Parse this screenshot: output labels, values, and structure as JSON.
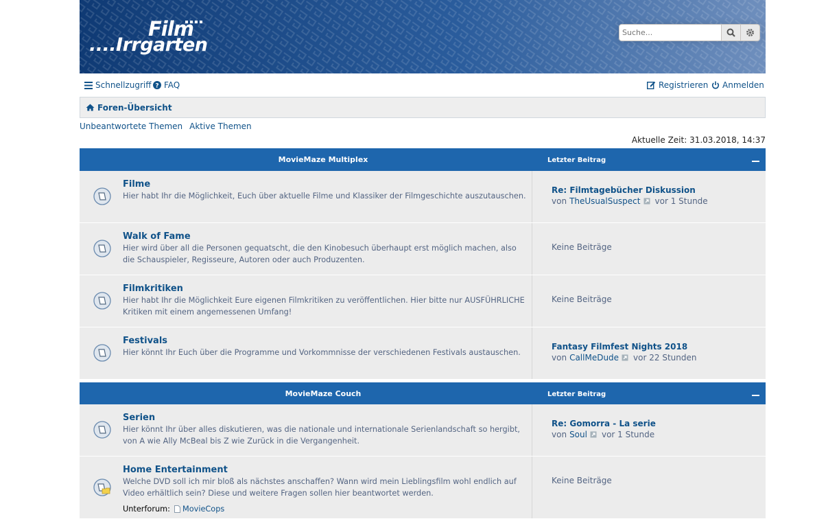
{
  "header": {
    "logo_top": "Film",
    "logo_bottom": "....Irrgarten",
    "search_placeholder": "Suche...",
    "search_icon": "search-icon",
    "advanced_icon": "gear-icon"
  },
  "nav": {
    "quick_access": "Schnellzugriff",
    "faq": "FAQ",
    "register": "Registrieren",
    "login": "Anmelden"
  },
  "breadcrumb": {
    "home": "Foren-Übersicht"
  },
  "quicklinks": {
    "unanswered": "Unbeantwortete Themen",
    "active": "Aktive Themen"
  },
  "time": "Aktuelle Zeit: 31.03.2018, 14:37",
  "colors": {
    "header": "#12407b",
    "category": "#1e66ad",
    "link": "#105289",
    "row": "#ececec"
  },
  "categories": [
    {
      "title": "MovieMaze Multiplex",
      "last_label": "Letzter Beitrag",
      "forums": [
        {
          "title": "Filme",
          "desc": "Hier habt Ihr die Möglichkeit, Euch über aktuelle Filme und Klassiker der Filmgeschichte auszutauschen.",
          "last_title": "Re: Filmtagebücher Diskussion",
          "by": "von",
          "user": "TheUsualSuspect",
          "when": "vor 1 Stunde"
        },
        {
          "title": "Walk of Fame",
          "desc": "Hier wird über all die Personen gequatscht, die den Kinobesuch überhaupt erst möglich machen, also die Schauspieler, Regisseure, Autoren oder auch Produzenten.",
          "none": "Keine Beiträge"
        },
        {
          "title": "Filmkritiken",
          "desc": "Hier habt Ihr die Möglichkeit Eure eigenen Filmkritiken zu veröffentlichen. Hier bitte nur AUSFÜHRLICHE Kritiken mit einem angemessenen Umfang!",
          "none": "Keine Beiträge"
        },
        {
          "title": "Festivals",
          "desc": "Hier könnt Ihr Euch über die Programme und Vorkommnisse der verschiedenen Festivals austauschen.",
          "last_title": "Fantasy Filmfest Nights 2018",
          "by": "von",
          "user": "CallMeDude",
          "when": "vor 22 Stunden"
        }
      ]
    },
    {
      "title": "MovieMaze Couch",
      "last_label": "Letzter Beitrag",
      "forums": [
        {
          "title": "Serien",
          "desc": "Hier könnt Ihr über alles diskutieren, was die nationale und internationale Serienlandschaft so hergibt, von A wie Ally McBeal bis Z wie Zurück in die Vergangenheit.",
          "last_title": "Re: Gomorra - La serie",
          "by": "von",
          "user": "Soul",
          "when": "vor 1 Stunde"
        },
        {
          "title": "Home Entertainment",
          "desc": "Welche DVD soll ich mir bloß als nächstes anschaffen? Wann wird mein Lieblingsfilm wohl endlich auf Video erhältlich sein? Diese und weitere Fragen sollen hier beantwortet werden.",
          "subforum_label": "Unterforum:",
          "subforum": "MovieCops",
          "none": "Keine Beiträge"
        }
      ]
    }
  ]
}
